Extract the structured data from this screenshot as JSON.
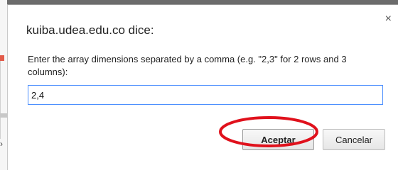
{
  "dialog": {
    "title": "kuiba.udea.edu.co dice:",
    "message": "Enter the array dimensions separated by a comma (e.g. \"2,3\" for 2 rows and 3 columns):",
    "input_value": "2,4",
    "close_glyph": "×",
    "accept_label": "Aceptar",
    "cancel_label": "Cancelar"
  },
  "annotation": {
    "highlight_color": "#e0111c",
    "highlights": "accept-button"
  },
  "background": {
    "chevron_glyph": "›"
  }
}
